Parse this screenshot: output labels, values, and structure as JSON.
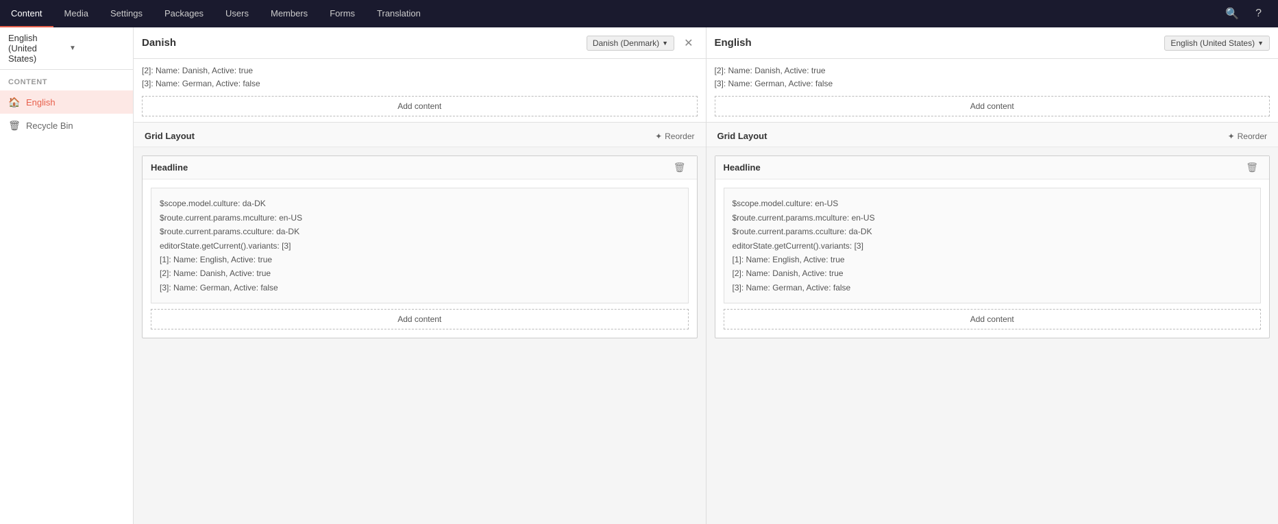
{
  "nav": {
    "items": [
      {
        "label": "Content",
        "active": true
      },
      {
        "label": "Media",
        "active": false
      },
      {
        "label": "Settings",
        "active": false
      },
      {
        "label": "Packages",
        "active": false
      },
      {
        "label": "Users",
        "active": false
      },
      {
        "label": "Members",
        "active": false
      },
      {
        "label": "Forms",
        "active": false
      },
      {
        "label": "Translation",
        "active": false
      }
    ],
    "search_icon": "🔍",
    "help_icon": "?"
  },
  "sidebar": {
    "lang_selector": "English (United States)",
    "content_label": "Content",
    "items": [
      {
        "id": "english",
        "label": "English",
        "icon": "🏠",
        "active": true
      },
      {
        "id": "recycle-bin",
        "label": "Recycle Bin",
        "icon": "🗑",
        "active": false
      }
    ]
  },
  "left_pane": {
    "title": "Danish",
    "lang_badge": "Danish (Denmark)",
    "show_close": true,
    "top_content": {
      "lines": [
        "[2]: Name: Danish, Active: true",
        "[3]: Name: German, Active: false"
      ]
    },
    "add_content_label": "Add content",
    "grid_layout_label": "Grid Layout",
    "reorder_label": "Reorder",
    "headline_block": {
      "title": "Headline",
      "content": {
        "scope_culture": "$scope.model.culture: da-DK",
        "route_mculture": "$route.current.params.mculture: en-US",
        "route_cculture": "$route.current.params.cculture: da-DK",
        "variants_count": "editorState.getCurrent().variants: [3]",
        "variant_1": "[1]: Name: English, Active: true",
        "variant_2": "[2]: Name: Danish, Active: true",
        "variant_3": "[3]: Name: German, Active: false"
      },
      "add_content_label": "Add content"
    }
  },
  "right_pane": {
    "title": "English",
    "lang_badge": "English (United States)",
    "show_close": false,
    "top_content": {
      "lines": [
        "[2]: Name: Danish, Active: true",
        "[3]: Name: German, Active: false"
      ]
    },
    "add_content_label": "Add content",
    "grid_layout_label": "Grid Layout",
    "reorder_label": "Reorder",
    "headline_block": {
      "title": "Headline",
      "content": {
        "scope_culture": "$scope.model.culture: en-US",
        "route_mculture": "$route.current.params.mculture: en-US",
        "route_cculture": "$route.current.params.cculture: da-DK",
        "variants_count": "editorState.getCurrent().variants: [3]",
        "variant_1": "[1]: Name: English, Active: true",
        "variant_2": "[2]: Name: Danish, Active: true",
        "variant_3": "[3]: Name: German, Active: false"
      },
      "add_content_label": "Add content"
    }
  }
}
